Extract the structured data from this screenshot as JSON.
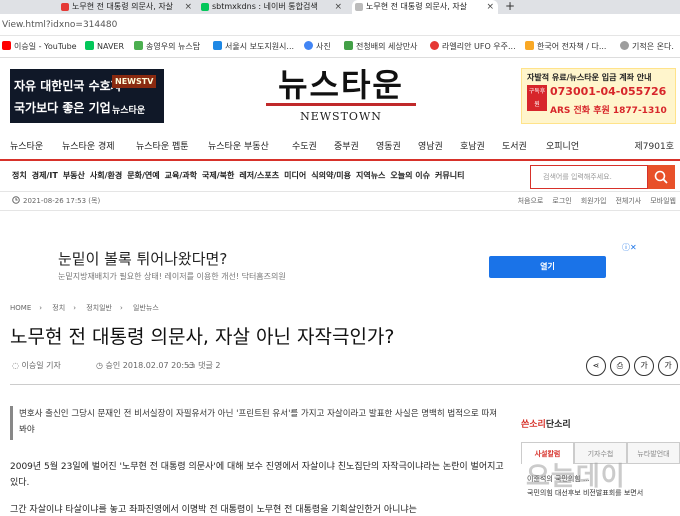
{
  "browser": {
    "tabs": [
      {
        "label": "노무현 전 대통령 의문사, 자살",
        "color": "#e53935"
      },
      {
        "label": "sbtmxkdns : 네이버 통합검색",
        "color": "#03c75a"
      },
      {
        "label": "노무현 전 대통령 의문사, 자살",
        "color": "#555555"
      }
    ],
    "address": "View.html?idxno=314480",
    "bookmarks": [
      {
        "label": "이승일 - YouTube",
        "color": "#ff0000"
      },
      {
        "label": "NAVER",
        "color": "#03c75a"
      },
      {
        "label": "송영우의 뉴스탑",
        "color": "#4caf50"
      },
      {
        "label": "서울시 보도지원시...",
        "color": "#1e88e5"
      },
      {
        "label": "사진",
        "color": "#4285f4"
      },
      {
        "label": "전청배의 세상만사",
        "color": "#43a047"
      },
      {
        "label": "라엘리안 UFO 우주...",
        "color": "#e53935"
      },
      {
        "label": "한국어 전자책 / 다...",
        "color": "#f9a825"
      },
      {
        "label": "기적은 온다.",
        "color": "#9e9e9e"
      }
    ]
  },
  "banner_left": {
    "line1": "자유 대한민국 수호자",
    "line2": "국가보다 좋은 기업",
    "tag1": "NEWSTV",
    "tag2": "뉴스타운"
  },
  "logo": {
    "korean": "뉴스타운",
    "english": "NEWSTOWN"
  },
  "banner_right": {
    "line1": "자발적 유료/뉴스타운 입금 계좌 안내",
    "badge": "구독후원",
    "account": "073001-04-055726",
    "phone": "ARS 전화 후원 1877-1310"
  },
  "nav_primary": [
    "뉴스타운",
    "뉴스타운 경제",
    "뉴스타운 펩툰",
    "뉴스타운 부동산",
    "수도권",
    "중부권",
    "영동권",
    "영남권",
    "호남권",
    "도서권",
    "오피니언"
  ],
  "issue_number": "제7901호",
  "nav_categories": [
    "정치",
    "경제/IT",
    "부동산",
    "사회/환경",
    "문화/연예",
    "교육/과학",
    "국제/북한",
    "레저/스포츠",
    "미디어",
    "식의약/미용",
    "지역뉴스",
    "오늘의 이슈",
    "커뮤니티"
  ],
  "search": {
    "placeholder": "검색어를 입력해주세요."
  },
  "meta_bar": {
    "date": "2021-08-26 17:53 (목)",
    "links": [
      "처음으로",
      "로그인",
      "회원가입",
      "전체기사",
      "모바일웹"
    ]
  },
  "ad": {
    "headline": "눈밑이 볼록 튀어나왔다면?",
    "sub": "눈밑지방재배치가 필요한 상태! 레이저를 이용한 개선! 닥터홈즈의원",
    "button": "열기"
  },
  "breadcrumb": [
    "HOME",
    "정치",
    "정치일반",
    "일반뉴스"
  ],
  "article": {
    "headline": "노무현 전 대통령 의문사, 자살 아닌 자작극인가?",
    "author": "이승일 기자",
    "approved": "승인 2018.02.07 20:53",
    "comments": "댓글 2",
    "summary": "변호사 출신인 그당시 문재인 전 비서실장이 자필유서가 아닌 '프린트된 유서'를 가지고 자살이라고 발표한 사실은 명백히 법적으로 따져봐야",
    "para1": "2009년 5월 23일에 벌어진 '노무현 전 대통령 의문사'에 대해 보수 진영에서 자살이냐 친노집단의 자작극이냐라는 논란이 벌어지고 있다.",
    "para2": "그간 자살이냐 타살이냐를 놓고 좌파진영에서 이명박 전 대통령이 노무현 전 대통령을 기획살인한거 아니냐는"
  },
  "tools": [
    "공유",
    "인쇄",
    "글씨",
    "기사"
  ],
  "sidebar": {
    "title_red": "쓴소리",
    "title_rest": "단소리",
    "tabs": [
      "사설칼럼",
      "기자수첩",
      "뉴타발언대"
    ],
    "items": [
      "이준석의 국민의힘 ...",
      "국민의힘 대선후보 비전발표회를 보면서"
    ]
  },
  "watermark": "오늘데이"
}
